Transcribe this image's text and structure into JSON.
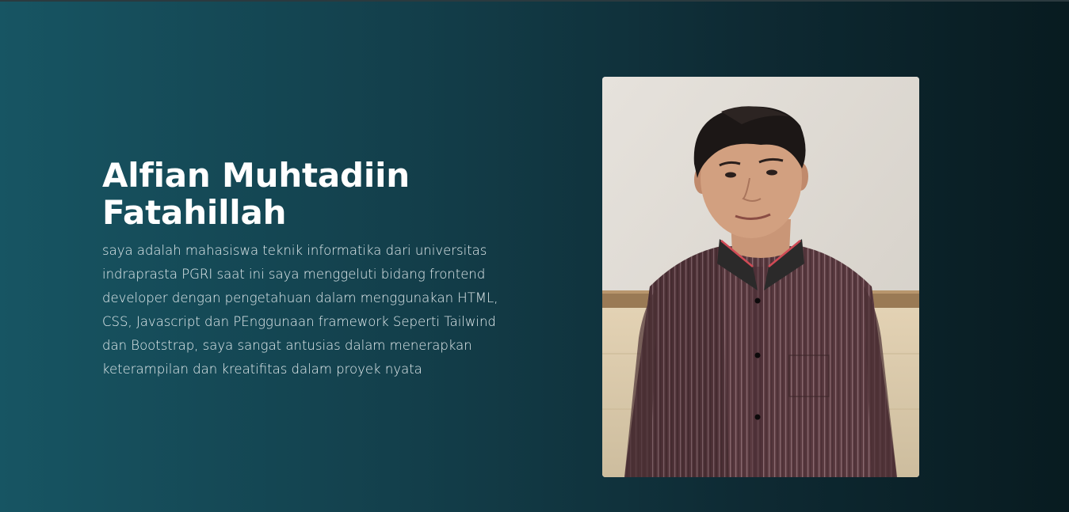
{
  "hero": {
    "title_line1": "Alfian Muhtadiin",
    "title_line2": "Fatahillah",
    "description": "saya adalah mahasiswa teknik informatika dari universitas indraprasta PGRI saat ini saya menggeluti bidang frontend developer dengan pengetahuan dalam menggunakan HTML, CSS, Javascript dan PEnggunaan framework Seperti Tailwind dan Bootstrap, saya sangat antusias dalam menerapkan keterampilan dan kreatifitas dalam proyek nyata"
  },
  "photo": {
    "subject": "profile-photo"
  },
  "colors": {
    "background_left": "#175563",
    "background_right": "#081b20",
    "text": "#ffffff"
  }
}
